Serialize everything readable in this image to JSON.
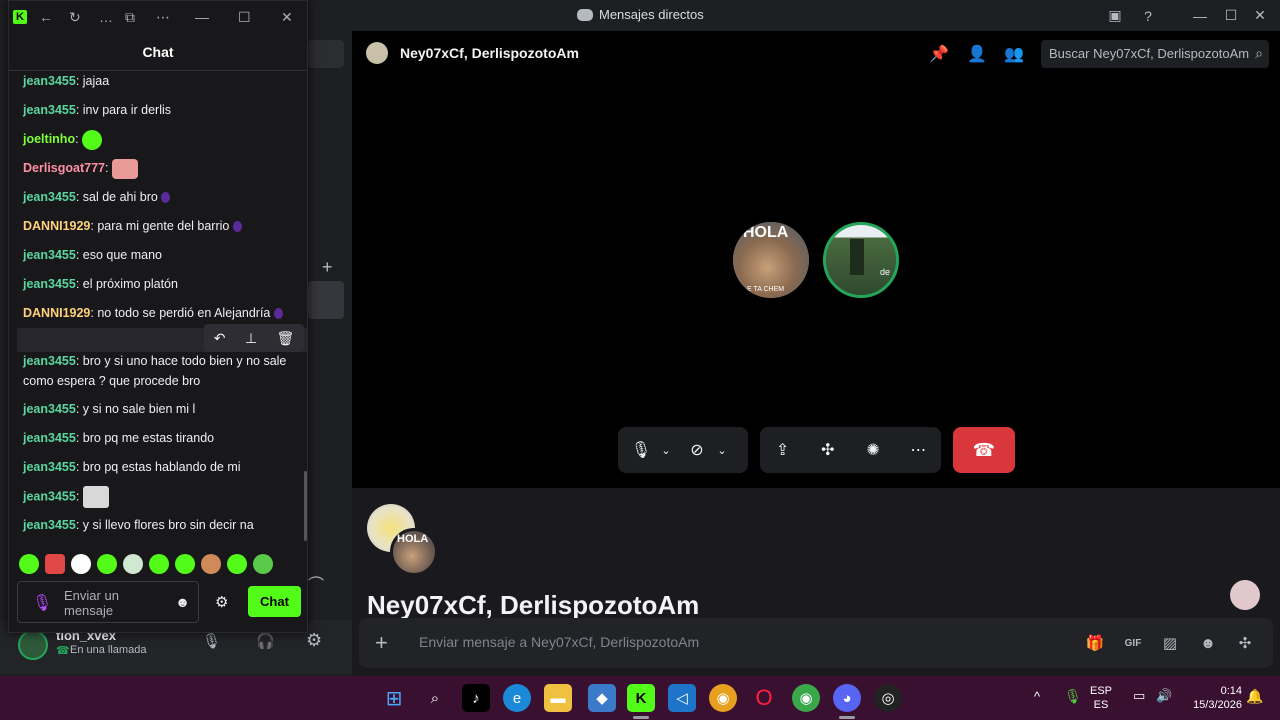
{
  "discord": {
    "window_title": "Mensajes directos",
    "conversation_name": "Ney07xCf, DerlispozotoAm",
    "search_placeholder": "Buscar Ney07xCf, DerlispozotoAm",
    "conversation_heading": "Ney07xCf, DerlispozotoAm",
    "message_placeholder": "Enviar mensaje a Ney07xCf, DerlispozotoAm",
    "user": {
      "name": "tion_xvex",
      "status": "En una llamada"
    },
    "avatar_text": "HOLA",
    "avatar_caption": "E TA CHEM",
    "avatar2_text": "de"
  },
  "kick": {
    "title": "Chat",
    "messages": [
      {
        "user": "jean3455",
        "text": ": jajaa",
        "color": "#5ad6a0"
      },
      {
        "user": "jean3455",
        "text": ": inv para ir derlis",
        "color": "#5ad6a0"
      },
      {
        "user": "joeltinho",
        "text": ":",
        "color": "#7dff3a",
        "emote": "green-emote"
      },
      {
        "user": "Derlisgoat777",
        "text": ":",
        "color": "#ff8fa3",
        "emote": "hand-emote"
      },
      {
        "user": "jean3455",
        "text": ": sal de ahi bro",
        "color": "#5ad6a0",
        "emote": "purple-emote"
      },
      {
        "user": "DANNI1929",
        "text": ": para mi gente del barrio",
        "color": "#ffd27a",
        "emote": "purple-emote"
      },
      {
        "user": "jean3455",
        "text": ": eso que mano",
        "color": "#5ad6a0"
      },
      {
        "user": "jean3455",
        "text": ": el próximo platón",
        "color": "#5ad6a0"
      },
      {
        "user": "DANNI1929",
        "text": ": no todo se perdió en Alejandría",
        "color": "#ffd27a",
        "emote": "purple-emote"
      },
      {
        "user": "jean3455",
        "text": ": bro y si uno hace todo bien y no sale como espera ? que procede bro",
        "color": "#5ad6a0"
      },
      {
        "user": "jean3455",
        "text": ": y si no sale bien mi l",
        "color": "#5ad6a0"
      },
      {
        "user": "jean3455",
        "text": ": bro pq me estas tirando",
        "color": "#5ad6a0"
      },
      {
        "user": "jean3455",
        "text": ": bro pq estas hablando de mi",
        "color": "#5ad6a0"
      },
      {
        "user": "jean3455",
        "text": ":",
        "color": "#5ad6a0",
        "emote": "cat-emote"
      },
      {
        "user": "jean3455",
        "text": ": y si llevo flores bro sin decir na",
        "color": "#5ad6a0"
      }
    ],
    "input_placeholder": "Enviar un mensaje",
    "send_label": "Chat"
  },
  "taskbar": {
    "lang_line1": "ESP",
    "lang_line2": "ES",
    "time": "0:14",
    "date": "15/3/2026"
  },
  "colors": {
    "kick_green": "#53fc18",
    "hangup_red": "#da373c",
    "taskbar_bg": "#3a1030"
  }
}
